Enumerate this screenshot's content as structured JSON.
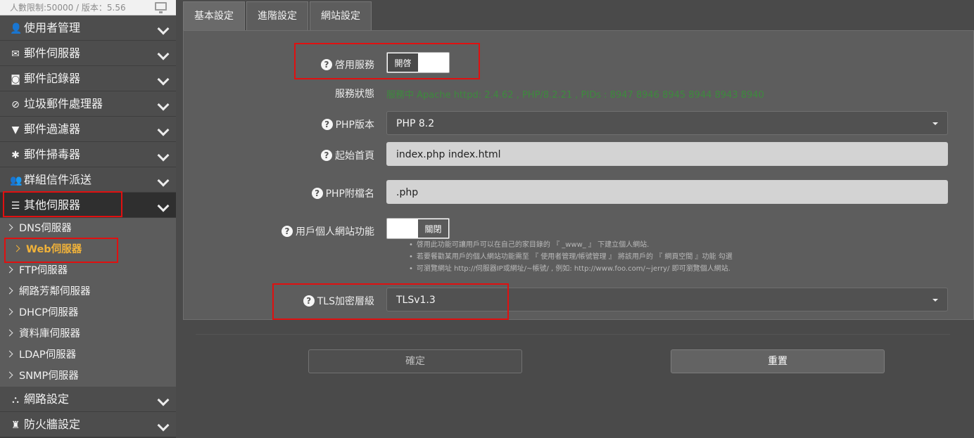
{
  "header": {
    "info": "人數限制:50000 / 版本：5.56"
  },
  "sidebar": {
    "items": [
      {
        "label": "使用者管理"
      },
      {
        "label": "郵件伺服器"
      },
      {
        "label": "郵件記錄器"
      },
      {
        "label": "垃圾郵件處理器"
      },
      {
        "label": "郵件過濾器"
      },
      {
        "label": "郵件掃毒器"
      },
      {
        "label": "群組信件派送"
      },
      {
        "label": "其他伺服器"
      },
      {
        "label": "網路設定"
      },
      {
        "label": "防火牆設定"
      }
    ],
    "sub_items": [
      {
        "label": "DNS伺服器"
      },
      {
        "label": "Web伺服器"
      },
      {
        "label": "FTP伺服器"
      },
      {
        "label": "網路芳鄰伺服器"
      },
      {
        "label": "DHCP伺服器"
      },
      {
        "label": "資料庫伺服器"
      },
      {
        "label": "LDAP伺服器"
      },
      {
        "label": "SNMP伺服器"
      }
    ]
  },
  "tabs": [
    {
      "label": "基本設定"
    },
    {
      "label": "進階設定"
    },
    {
      "label": "網站設定"
    }
  ],
  "form": {
    "enable_service": {
      "label": "啓用服務",
      "state": "開啓"
    },
    "service_status": {
      "label": "服務狀態",
      "value": "服務中 Apache httpd: 2.4.62 , PHP/8.2.21 , PIDs : 8947 8946 8945 8944 8943 8940"
    },
    "php_version": {
      "label": "PHP版本",
      "value": "PHP 8.2"
    },
    "index_page": {
      "label": "起始首頁",
      "value": "index.php index.html"
    },
    "php_ext": {
      "label": "PHP附檔名",
      "value": ".php"
    },
    "user_site": {
      "label": "用戶個人網站功能",
      "state": "關閉"
    },
    "notes": [
      "啓用此功能可讓用戶可以在自己的家目錄的 『 _www_ 』 下建立個人網站.",
      "若要餐勸某用戶的個人網站功能需至 『 使用者管理/帳號管理 』 將該用戶的 『 網頁空間 』功能 勾選",
      "可瀏覽網址 http://伺服器IP或網址/~帳號/ , 例如: http://www.foo.com/~jerry/ 即可瀏覽個人網站."
    ],
    "tls_level": {
      "label": "TLS加密層級",
      "value": "TLSv1.3"
    }
  },
  "buttons": {
    "confirm": "確定",
    "reset": "重置"
  },
  "colors": {
    "highlight_box": "#e01010",
    "selected_item": "#f0b23a",
    "status_text": "#3d8a3d"
  }
}
